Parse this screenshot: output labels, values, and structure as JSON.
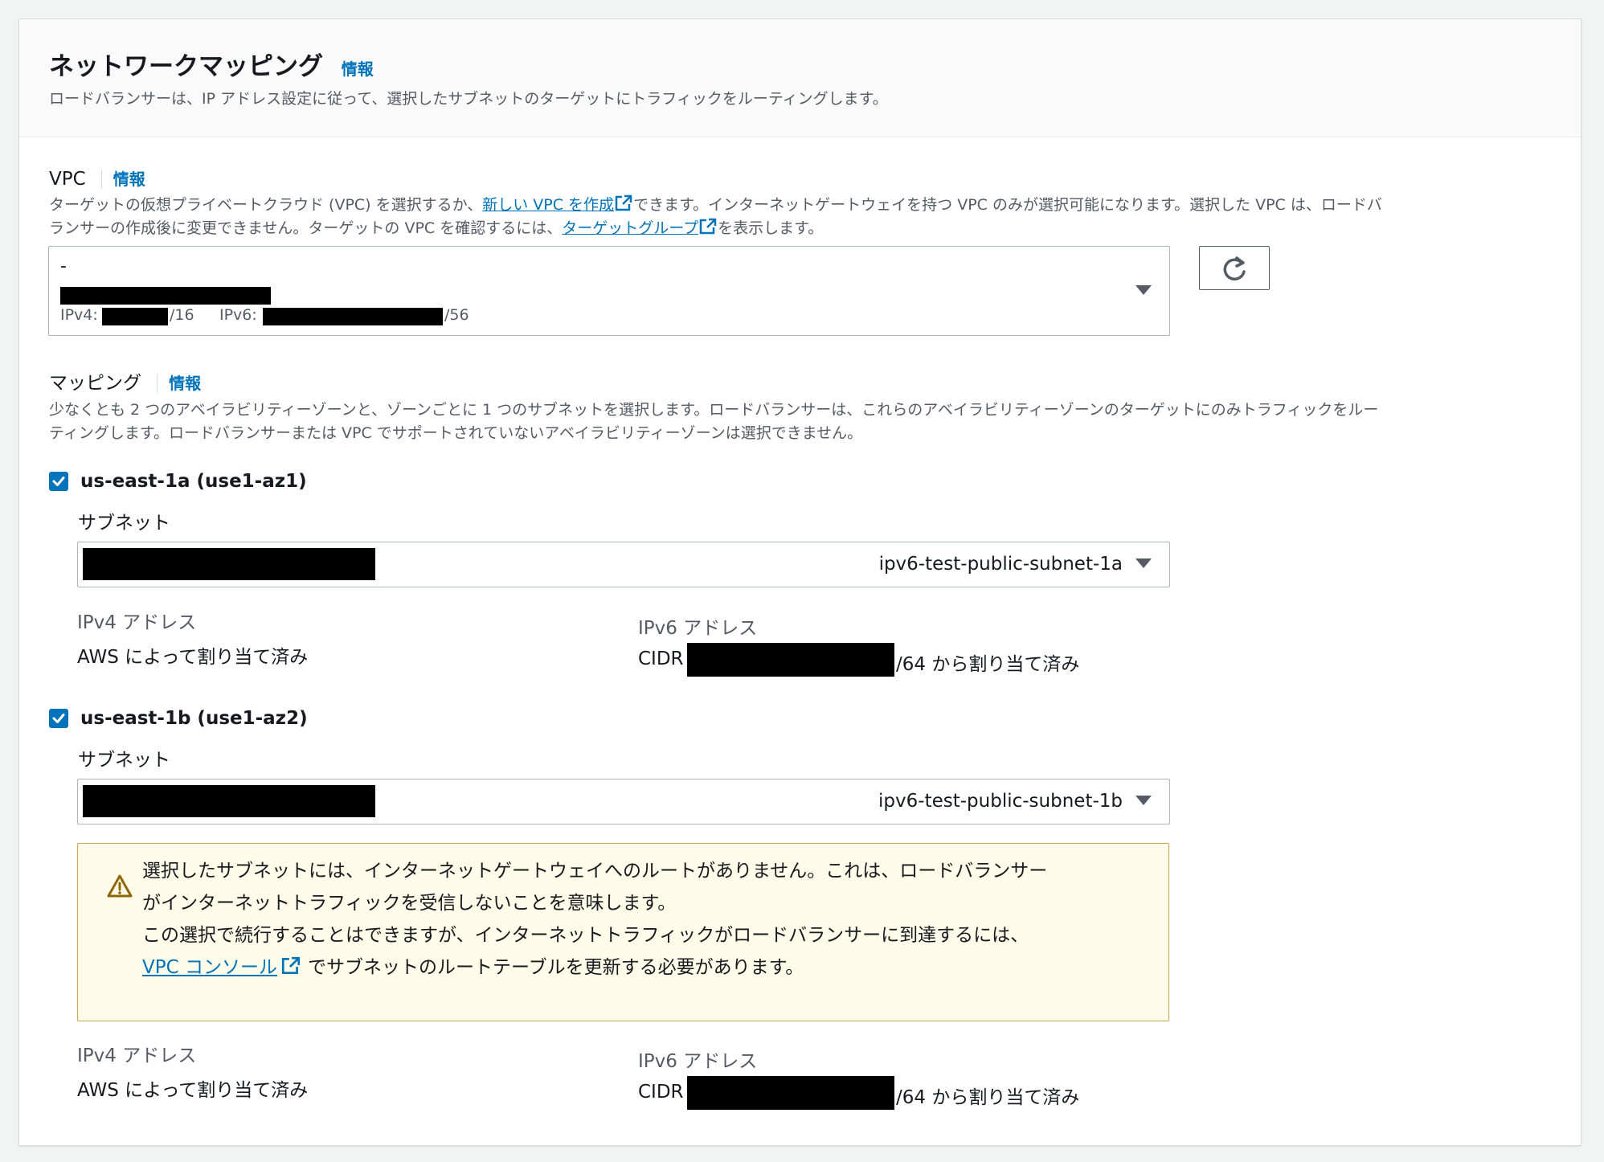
{
  "header": {
    "title": "ネットワークマッピング",
    "info": "情報",
    "description": "ロードバランサーは、IP アドレス設定に従って、選択したサブネットのターゲットにトラフィックをルーティングします。"
  },
  "vpc": {
    "label": "VPC",
    "info": "情報",
    "desc1_a": "ターゲットの仮想プライベートクラウド (VPC) を選択するか、",
    "desc1_link": "新しい VPC を作成",
    "desc1_b": "できます。インターネットゲートウェイを持つ VPC のみが選択可能になります。選択した VPC は、ロードバ",
    "desc2_a": "ランサーの作成後に変更できません。ターゲットの VPC を確認するには、",
    "desc2_link": "ターゲットグループ",
    "desc2_b": "を表示します。",
    "selected_name": "-",
    "ipv4_label": "IPv4:",
    "ipv4_suffix": "/16",
    "ipv6_label": "IPv6:",
    "ipv6_suffix": "/56"
  },
  "mapping": {
    "label": "マッピング",
    "info": "情報",
    "desc1": "少なくとも 2 つのアベイラビリティーゾーンと、ゾーンごとに 1 つのサブネットを選択します。ロードバランサーは、これらのアベイラビリティーゾーンのターゲットにのみトラフィックをルー",
    "desc2": "ティングします。ロードバランサーまたは VPC でサポートされていないアベイラビリティーゾーンは選択できません。"
  },
  "zones": [
    {
      "az": "us-east-1a (use1-az1)",
      "subnet_label": "サブネット",
      "subnet_value": "ipv6-test-public-subnet-1a",
      "ipv4_title": "IPv4 アドレス",
      "ipv4_value": "AWS によって割り当て済み",
      "ipv6_title": "IPv6 アドレス",
      "ipv6_prefix": "CIDR",
      "ipv6_suffix": "/64 から割り当て済み"
    },
    {
      "az": "us-east-1b (use1-az2)",
      "subnet_label": "サブネット",
      "subnet_value": "ipv6-test-public-subnet-1b",
      "ipv4_title": "IPv4 アドレス",
      "ipv4_value": "AWS によって割り当て済み",
      "ipv6_title": "IPv6 アドレス",
      "ipv6_prefix": "CIDR",
      "ipv6_suffix": "/64 から割り当て済み"
    }
  ],
  "warning": {
    "line1": "選択したサブネットには、インターネットゲートウェイへのルートがありません。これは、ロードバランサー",
    "line2": "がインターネットトラフィックを受信しないことを意味します。",
    "line3": "この選択で続行することはできますが、インターネットトラフィックがロードバランサーに到達するには、",
    "link": "VPC コンソール",
    "line4_b": "でサブネットのルートテーブルを更新する必要があります。"
  },
  "colors": {
    "link": "#0073bb",
    "checkbox": "#0073bb",
    "warning_bg": "#fffce9",
    "warning_border": "#d4a84c"
  },
  "icons": [
    "external-link-icon",
    "refresh-icon",
    "checkbox-checked-icon",
    "caret-down-icon",
    "warning-icon"
  ]
}
